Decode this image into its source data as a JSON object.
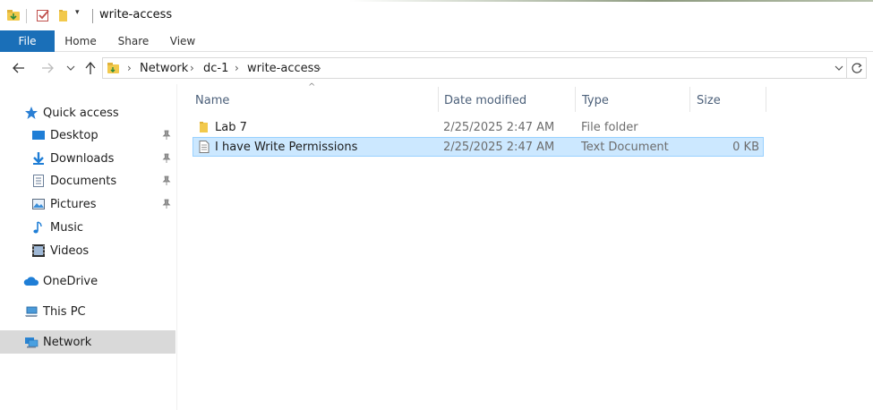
{
  "window": {
    "title": "write-access"
  },
  "ribbon": {
    "tabs": [
      "File",
      "Home",
      "Share",
      "View"
    ]
  },
  "address": {
    "crumbs": [
      "Network",
      "dc-1",
      "write-access"
    ]
  },
  "nav": {
    "quick_access": "Quick access",
    "items": [
      {
        "label": "Desktop",
        "icon": "desktop-icon",
        "pinned": true
      },
      {
        "label": "Downloads",
        "icon": "download-icon",
        "pinned": true
      },
      {
        "label": "Documents",
        "icon": "documents-icon",
        "pinned": true
      },
      {
        "label": "Pictures",
        "icon": "pictures-icon",
        "pinned": true
      },
      {
        "label": "Music",
        "icon": "music-icon",
        "pinned": false
      },
      {
        "label": "Videos",
        "icon": "videos-icon",
        "pinned": false
      }
    ],
    "onedrive": "OneDrive",
    "thispc": "This PC",
    "network": "Network"
  },
  "columns": {
    "name": "Name",
    "date": "Date modified",
    "type": "Type",
    "size": "Size"
  },
  "files": [
    {
      "name": "Lab 7",
      "date": "2/25/2025 2:47 AM",
      "type": "File folder",
      "size": "",
      "icon": "folder-icon",
      "selected": false
    },
    {
      "name": "I have Write Permissions",
      "date": "2/25/2025 2:47 AM",
      "type": "Text Document",
      "size": "0 KB",
      "icon": "text-file-icon",
      "selected": true
    }
  ],
  "colors": {
    "file_tab": "#1a6fb8",
    "selection": "#cce8ff",
    "selection_border": "#99d1ff",
    "nav_selected": "#d9d9d9",
    "header_text": "#4c607a"
  }
}
